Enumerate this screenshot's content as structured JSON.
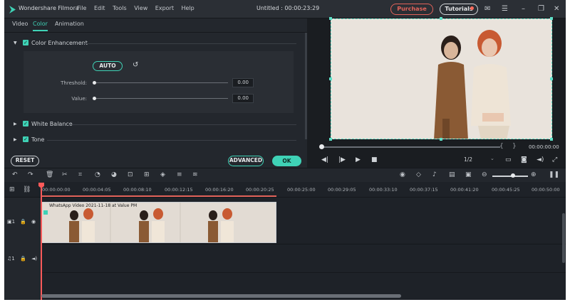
{
  "app": {
    "name": "Wondershare Filmora",
    "doc_title": "Untitled : 00:00:23:29"
  },
  "menu": [
    "File",
    "Edit",
    "Tools",
    "View",
    "Export",
    "Help"
  ],
  "buttons": {
    "purchase": "Purchase",
    "tutorials": "Tutorials"
  },
  "tabs": [
    {
      "label": "Video"
    },
    {
      "label": "Color",
      "active": true
    },
    {
      "label": "Animation"
    }
  ],
  "color_enhancement": {
    "title": "Color Enhancement",
    "auto_label": "AUTO",
    "threshold_label": "Threshold:",
    "threshold_value": "0.00",
    "value_label": "Value:",
    "value_value": "0.00"
  },
  "sections": {
    "white_balance": "White Balance",
    "tone": "Tone"
  },
  "actions": {
    "reset": "RESET",
    "advanced": "ADVANCED",
    "ok": "OK"
  },
  "player": {
    "time": "00:00:00:00",
    "ratio": "1/2"
  },
  "ruler": [
    "00:00:00:00",
    "00:00:04:05",
    "00:00:08:10",
    "00:00:12:15",
    "00:00:16:20",
    "00:00:20:25",
    "00:00:25:00",
    "00:00:29:05",
    "00:00:33:10",
    "00:00:37:15",
    "00:00:41:20",
    "00:00:45:25",
    "00:00:50:00"
  ],
  "clip": {
    "title": "WhatsApp Video 2021-11-18 at Value PM"
  },
  "colors": {
    "accent": "#3fd2b6",
    "purchase": "#e2635a",
    "playhead": "#ff5a5a"
  }
}
